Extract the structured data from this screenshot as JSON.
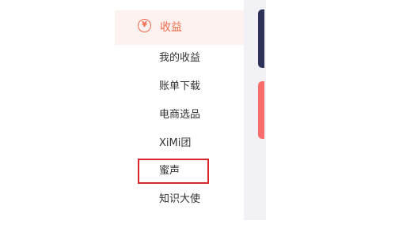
{
  "sidebar": {
    "section": {
      "icon": "yen-circle-icon",
      "icon_glyph": "¥",
      "label": "收益",
      "accent_color": "#f26a4b"
    },
    "items": [
      {
        "label": "我的收益"
      },
      {
        "label": "账单下载"
      },
      {
        "label": "电商选品"
      },
      {
        "label": "XiMi团"
      },
      {
        "label": "蜜声",
        "highlighted": true
      },
      {
        "label": "知识大使"
      }
    ]
  },
  "colors": {
    "dark_card": "#2d3259",
    "coral_card": "#f76e6c",
    "highlight_border": "#d9262c",
    "panel_bg": "#f2f2f6"
  }
}
